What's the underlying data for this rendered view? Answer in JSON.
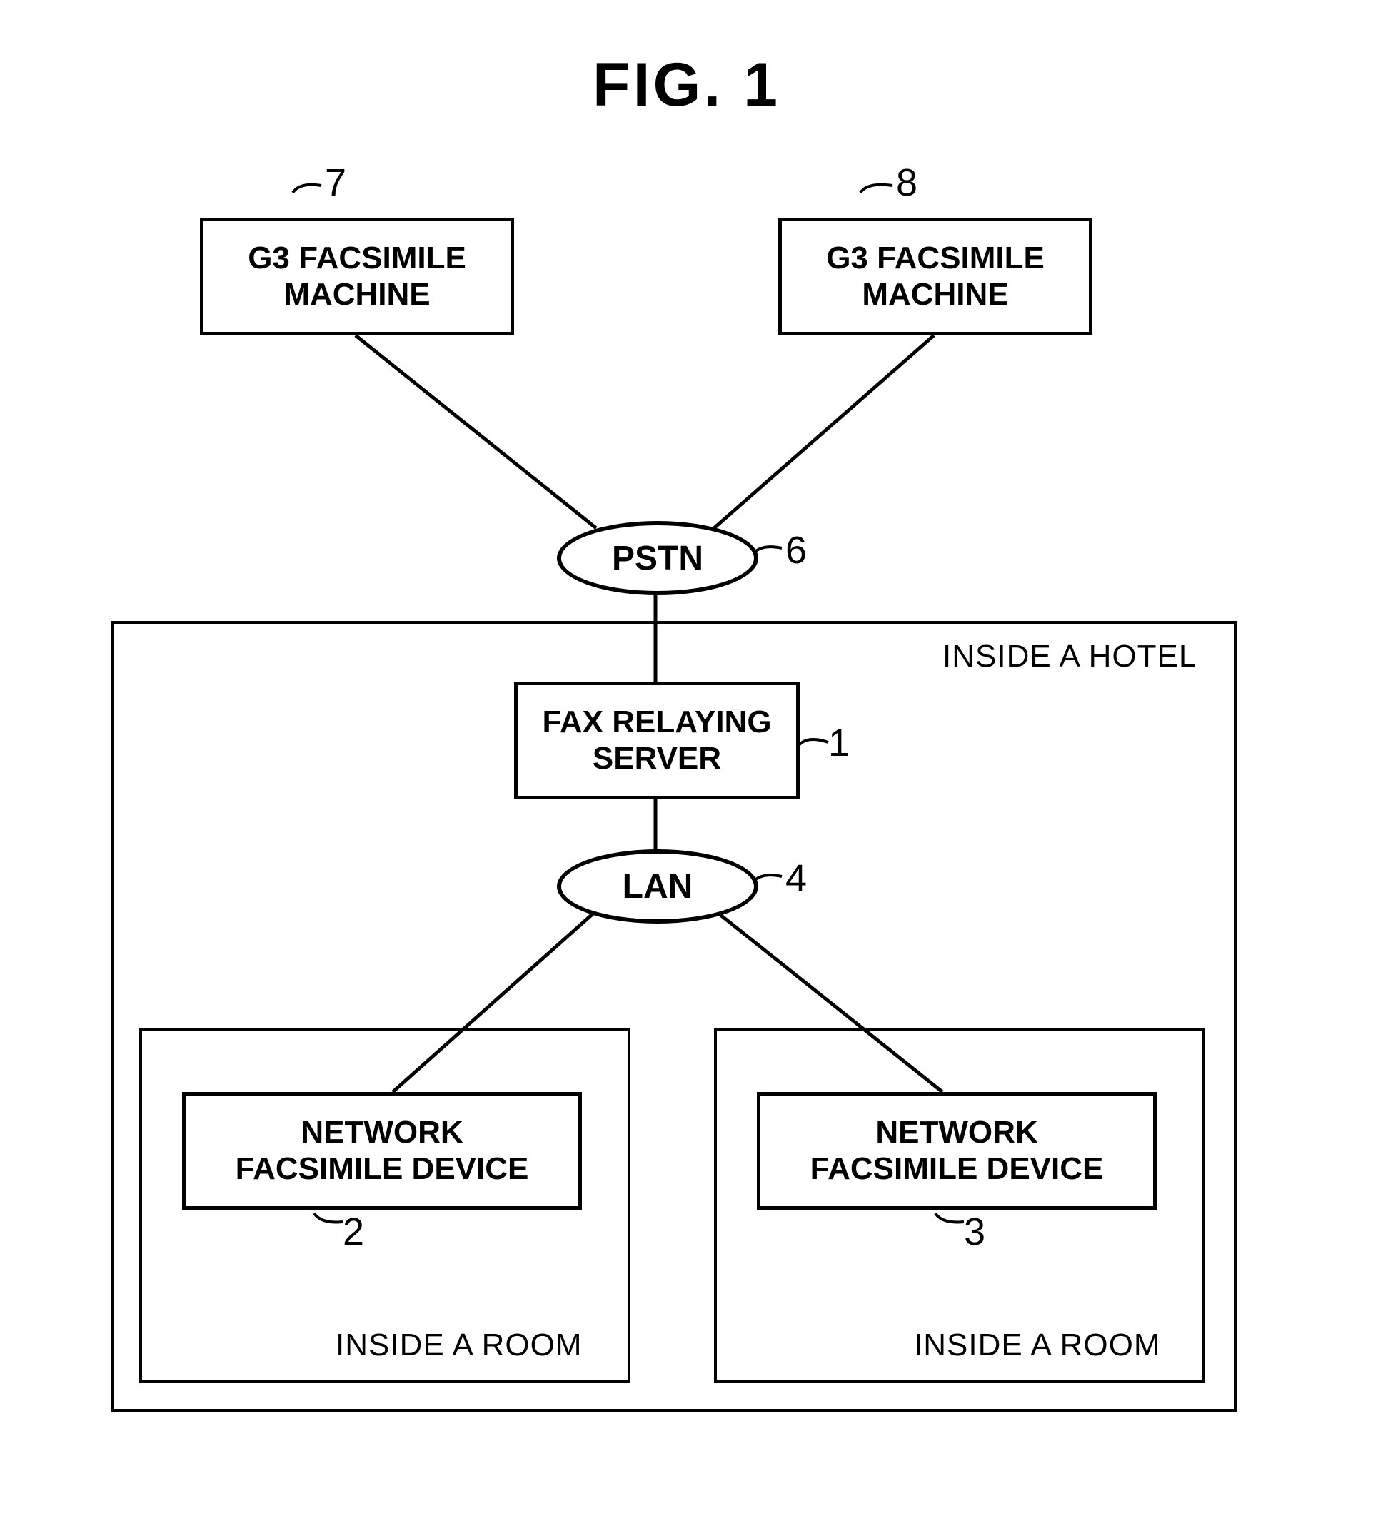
{
  "figure_title": "FIG. 1",
  "nodes": {
    "g3_left": {
      "label": "G3 FACSIMILE\nMACHINE",
      "num": "7"
    },
    "g3_right": {
      "label": "G3 FACSIMILE\nMACHINE",
      "num": "8"
    },
    "pstn": {
      "label": "PSTN",
      "num": "6"
    },
    "relay": {
      "label": "FAX RELAYING\nSERVER",
      "num": "1"
    },
    "lan": {
      "label": "LAN",
      "num": "4"
    },
    "nfd_left": {
      "label": "NETWORK\nFACSIMILE DEVICE",
      "num": "2"
    },
    "nfd_right": {
      "label": "NETWORK\nFACSIMILE DEVICE",
      "num": "3"
    }
  },
  "containers": {
    "hotel": "INSIDE A HOTEL",
    "room_left": "INSIDE A ROOM",
    "room_right": "INSIDE A ROOM"
  }
}
